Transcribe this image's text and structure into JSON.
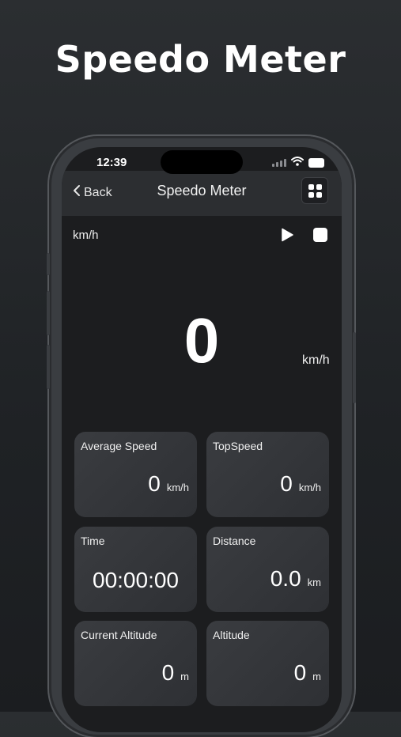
{
  "headline": "Speedo Meter",
  "status": {
    "time": "12:39"
  },
  "nav": {
    "back_label": "Back",
    "title": "Speedo Meter"
  },
  "speedometer": {
    "unit_label": "km/h",
    "speed": "0",
    "speed_unit": "km/h"
  },
  "cards": {
    "average_speed": {
      "label": "Average Speed",
      "value": "0",
      "unit": "km/h"
    },
    "top_speed": {
      "label": "TopSpeed",
      "value": "0",
      "unit": "km/h"
    },
    "time": {
      "label": "Time",
      "value": "00:00:00"
    },
    "distance": {
      "label": "Distance",
      "value": "0.0",
      "unit": "km"
    },
    "current_altitude": {
      "label": "Current Altitude",
      "value": "0",
      "unit": "m"
    },
    "altitude": {
      "label": "Altitude",
      "value": "0",
      "unit": "m"
    }
  },
  "icons": {
    "back": "chevron-left-icon",
    "menu": "grid-menu-icon",
    "play": "play-icon",
    "stop": "stop-icon",
    "wifi": "wifi-icon",
    "signal": "cellular-signal-icon",
    "battery": "battery-icon"
  }
}
